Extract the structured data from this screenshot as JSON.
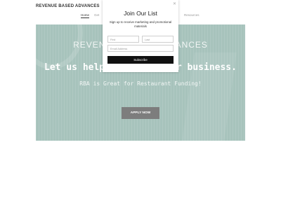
{
  "header": {
    "brand": "REVENUE BASED ADVANCES",
    "nav": [
      "Home",
      "Get",
      "Resources"
    ]
  },
  "hero": {
    "title": "REVENUE BASED ADVANCES",
    "headline": "Let us help you grow your business.",
    "subheadline": "RBA is Great for Restaurant Funding!",
    "cta": "APPLY NOW",
    "background_color": "#a7c3bc"
  },
  "popup": {
    "close_icon": "close-icon",
    "title": "Join Our List",
    "subtitle": "Sign up to receive marketing and promotional materials",
    "first_placeholder": "First",
    "last_placeholder": "Last",
    "email_placeholder": "Email Address",
    "subscribe": "Subscribe"
  }
}
